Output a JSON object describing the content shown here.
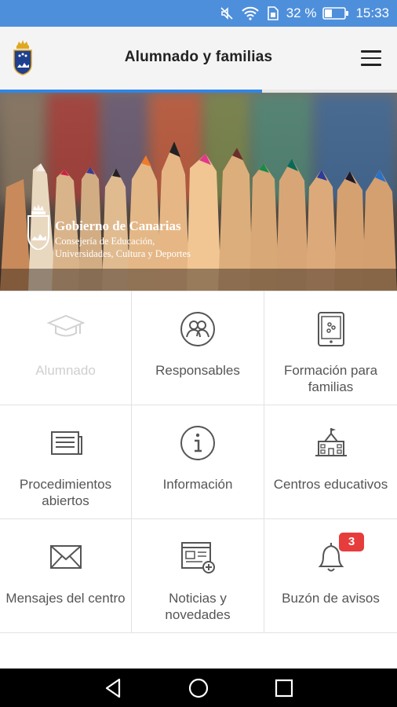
{
  "status_bar": {
    "battery": "32 %",
    "time": "15:33"
  },
  "app_bar": {
    "title": "Alumnado y familias"
  },
  "banner": {
    "brand_name": "Gobierno de Canarias",
    "brand_sub_1": "Consejería de Educación,",
    "brand_sub_2": "Universidades, Cultura y Deportes"
  },
  "grid": {
    "items": [
      {
        "label": "Alumnado",
        "icon": "graduation-cap-icon",
        "enabled": false
      },
      {
        "label": "Responsables",
        "icon": "people-icon",
        "enabled": true
      },
      {
        "label": "Formación para familias",
        "icon": "tablet-icon",
        "enabled": true
      },
      {
        "label": "Procedimientos abiertos",
        "icon": "newspaper-icon",
        "enabled": true
      },
      {
        "label": "Información",
        "icon": "info-icon",
        "enabled": true
      },
      {
        "label": "Centros educativos",
        "icon": "school-building-icon",
        "enabled": true
      },
      {
        "label": "Mensajes del centro",
        "icon": "envelope-icon",
        "enabled": true
      },
      {
        "label": "Noticias y novedades",
        "icon": "news-add-icon",
        "enabled": true
      },
      {
        "label": "Buzón de avisos",
        "icon": "bell-icon",
        "enabled": true,
        "badge": "3"
      }
    ]
  },
  "colors": {
    "status_bar": "#4e8fdb",
    "accent": "#2f86e8",
    "badge": "#e63c3c",
    "icon": "#555555"
  }
}
